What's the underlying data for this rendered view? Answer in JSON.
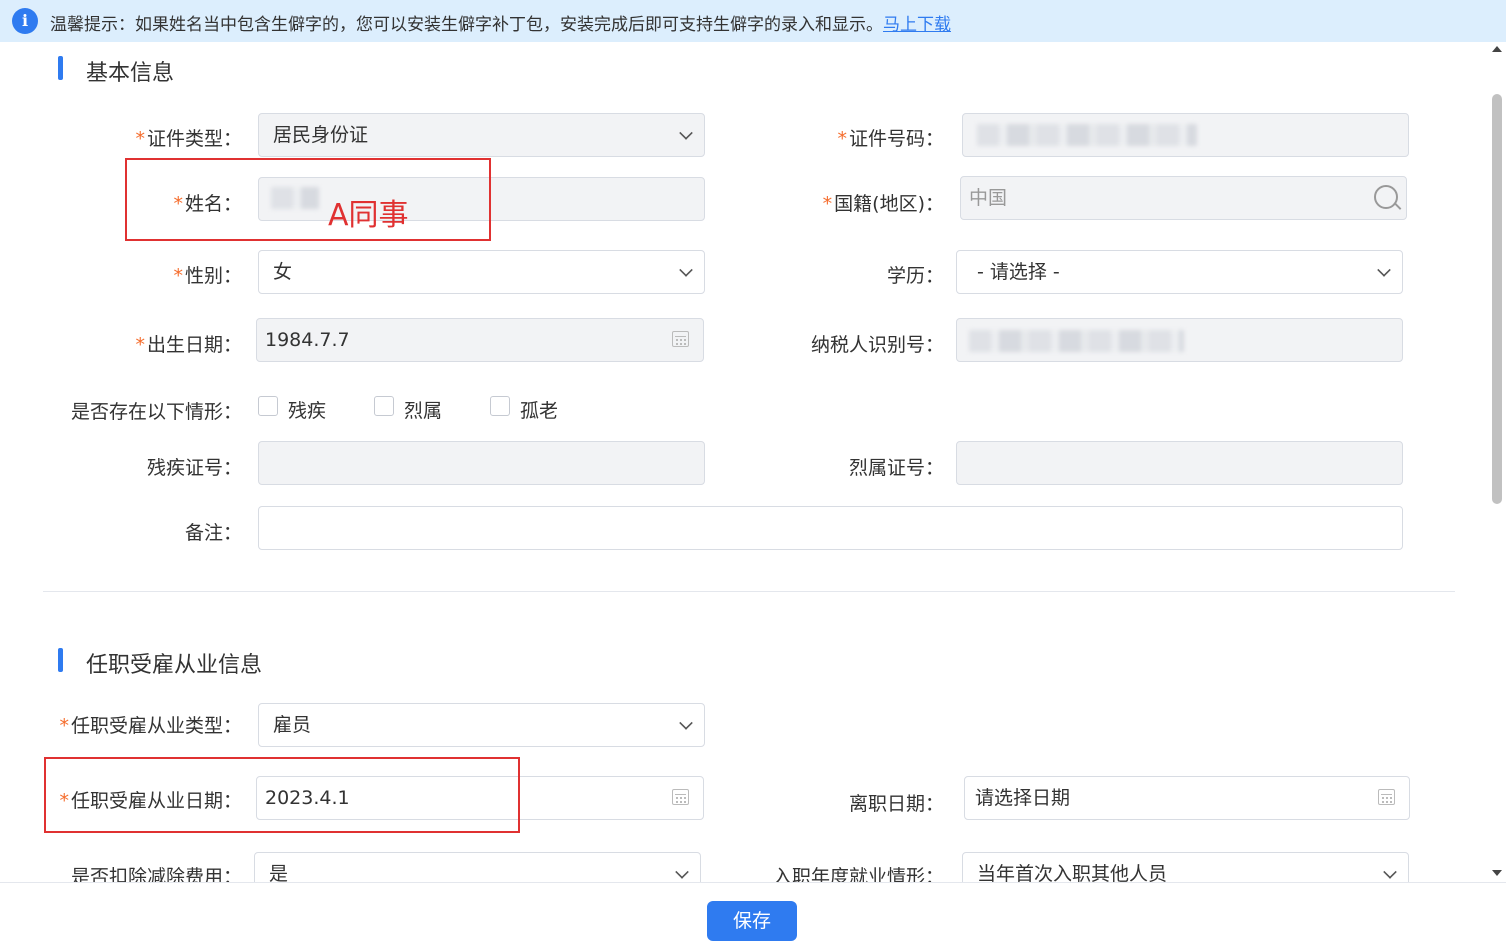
{
  "notice": {
    "icon": "info-icon",
    "text": "温馨提示：如果姓名当中包含生僻字的，您可以安装生僻字补丁包，安装完成后即可支持生僻字的录入和显示。",
    "link": "马上下载"
  },
  "basic": {
    "title": "基本信息",
    "id_type": {
      "label": "证件类型：",
      "value": "居民身份证"
    },
    "id_number": {
      "label": "证件号码："
    },
    "name": {
      "label": "姓名：",
      "annotation": "A同事"
    },
    "nationality": {
      "label": "国籍(地区)：",
      "value": "中国"
    },
    "gender": {
      "label": "性别：",
      "value": "女"
    },
    "education": {
      "label": "学历：",
      "value": "- 请选择 -"
    },
    "birth_date": {
      "label": "出生日期：",
      "value": "1984.7.7"
    },
    "taxpayer_id": {
      "label": "纳税人识别号："
    },
    "situations": {
      "label": "是否存在以下情形：",
      "options": [
        "残疾",
        "烈属",
        "孤老"
      ]
    },
    "disability_cert": {
      "label": "残疾证号："
    },
    "martyr_cert": {
      "label": "烈属证号："
    },
    "remarks": {
      "label": "备注："
    }
  },
  "employment": {
    "title": "任职受雇从业信息",
    "type": {
      "label": "任职受雇从业类型：",
      "value": "雇员"
    },
    "date": {
      "label": "任职受雇从业日期：",
      "value": "2023.4.1"
    },
    "leave_date": {
      "label": "离职日期：",
      "value": "请选择日期"
    },
    "deduct": {
      "label": "是否扣除减除费用：",
      "value": "是"
    },
    "entry_situation": {
      "label": "入职年度就业情形：",
      "value": "当年首次入职其他人员"
    }
  },
  "footer": {
    "save_label": "保存"
  },
  "colors": {
    "accent": "#2f7bf0",
    "required": "#f56c2c",
    "annotation": "#e03131"
  }
}
